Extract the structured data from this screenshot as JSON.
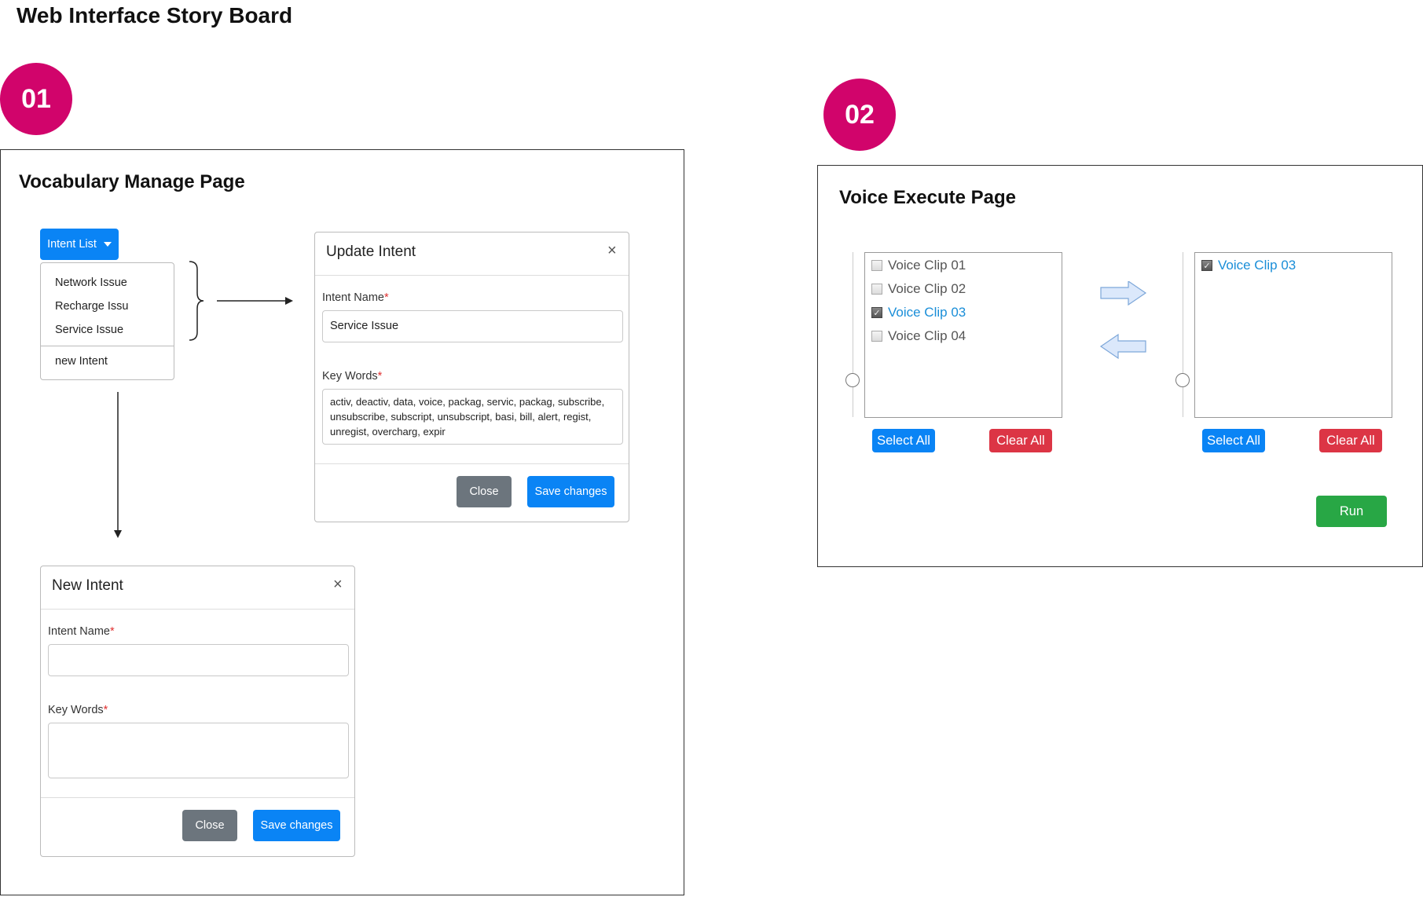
{
  "title": "Web Interface Story Board",
  "steps": [
    {
      "number": "01",
      "page_title": "Vocabulary Manage  Page"
    },
    {
      "number": "02",
      "page_title": "Voice Execute Page"
    }
  ],
  "vocab": {
    "dropdown_label": "Intent List",
    "dropdown_items": [
      "Network Issue",
      "Recharge Issu",
      "Service Issue"
    ],
    "new_intent_item": "new Intent",
    "update_modal": {
      "title": "Update Intent",
      "close_symbol": "×",
      "intent_name_label": "Intent Name",
      "required_mark": "*",
      "intent_name_value": "Service Issue",
      "keywords_label": "Key Words",
      "keywords_value": "activ, deactiv, data, voice, packag, servic, packag, subscribe, unsubscribe, subscript, unsubscript, basi, bill, alert, regist, unregist, overcharg, expir",
      "close_button": "Close",
      "save_button": "Save changes"
    },
    "new_modal": {
      "title": "New Intent",
      "close_symbol": "×",
      "intent_name_label": "Intent Name",
      "required_mark": "*",
      "intent_name_value": "",
      "keywords_label": "Key Words",
      "keywords_value": "",
      "close_button": "Close",
      "save_button": "Save changes"
    }
  },
  "voice": {
    "left_list": [
      {
        "label": "Voice Clip 01",
        "checked": false
      },
      {
        "label": "Voice Clip 02",
        "checked": false
      },
      {
        "label": "Voice Clip 03",
        "checked": true
      },
      {
        "label": "Voice Clip 04",
        "checked": false
      }
    ],
    "right_list": [
      {
        "label": "Voice Clip 03",
        "checked": true
      }
    ],
    "select_all": "Select All",
    "clear_all": "Clear All",
    "run_button": "Run",
    "check_mark": "✓"
  },
  "colors": {
    "badge": "#d1046b",
    "primary": "#0a84f5",
    "danger": "#dc3545",
    "success": "#28a745",
    "secondary": "#6c757d",
    "arrow_fill": "#dbe8fb",
    "arrow_stroke": "#7da7d9"
  }
}
